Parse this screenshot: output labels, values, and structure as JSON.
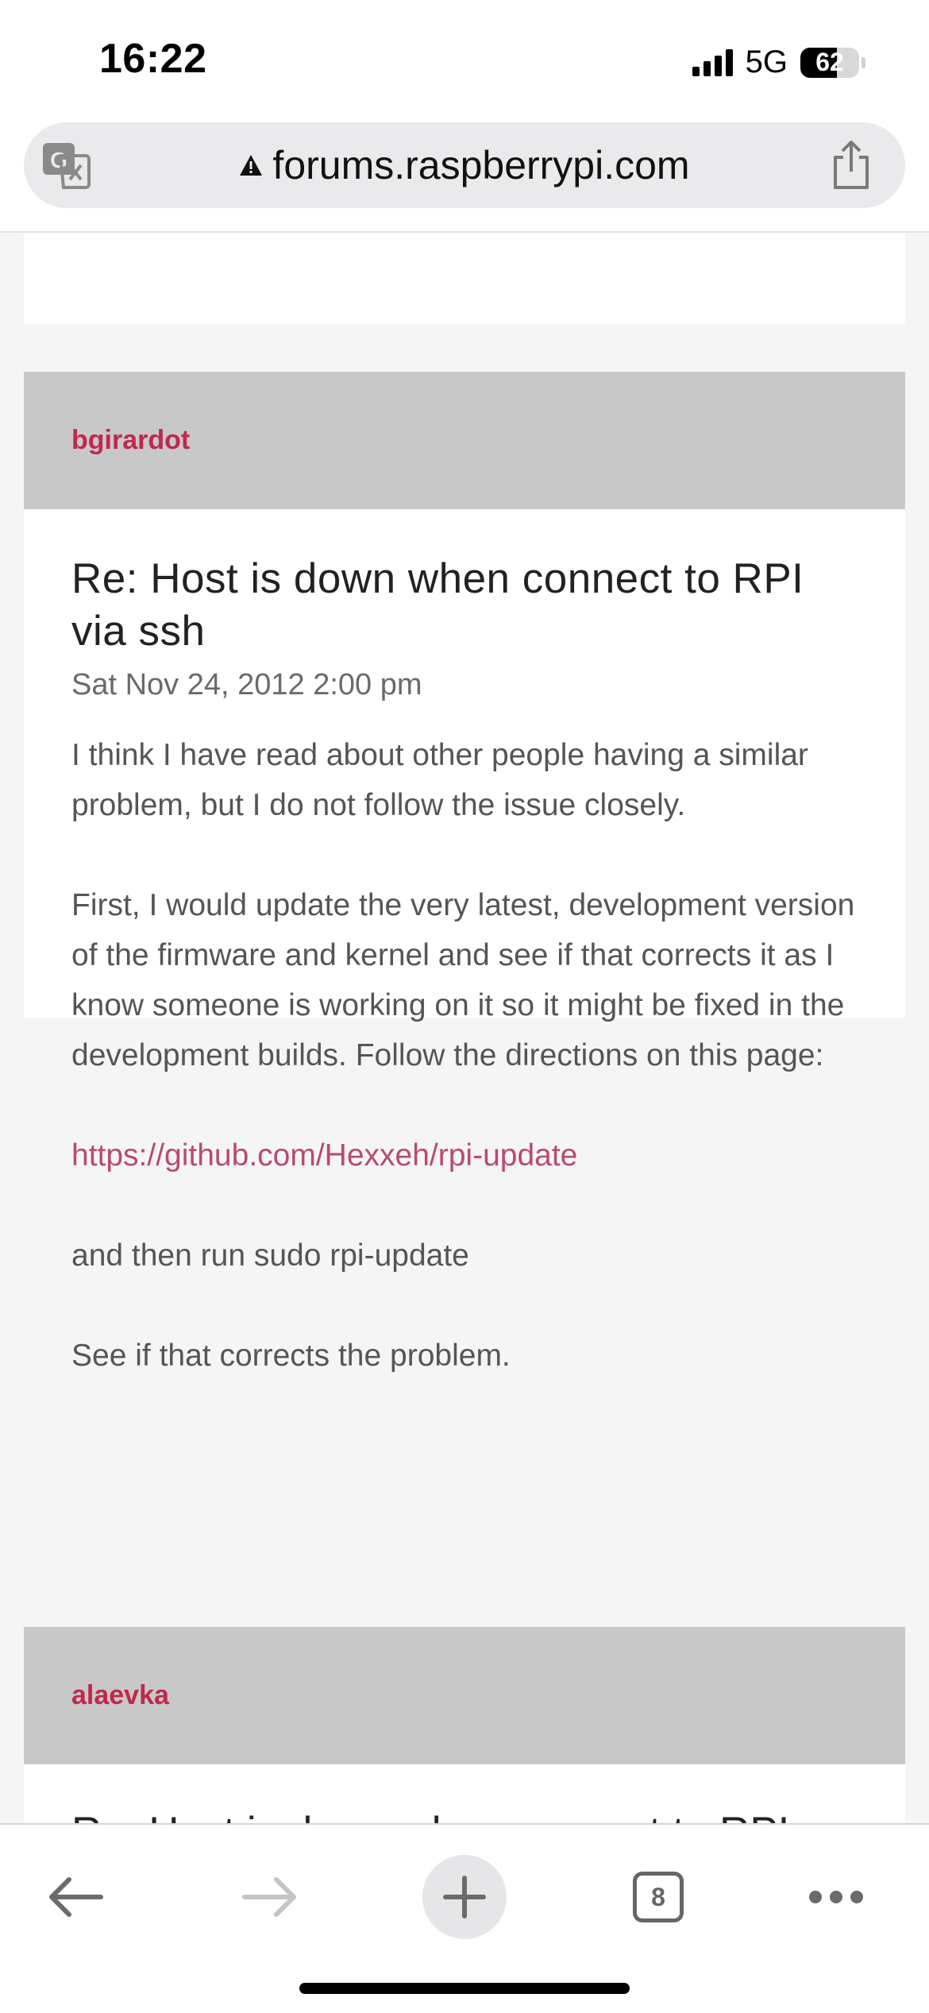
{
  "status_bar": {
    "time": "16:22",
    "network": "5G",
    "battery": "62",
    "battery_fraction": 0.62
  },
  "browser": {
    "url": "forums.raspberrypi.com",
    "tab_count": "8",
    "icons": {
      "translate": "translate-icon",
      "security": "warning-icon",
      "share": "share-icon",
      "back": "back-arrow-icon",
      "forward": "forward-arrow-icon",
      "new_tab": "plus-icon",
      "tabs": "tabs-icon",
      "more": "more-dots-icon"
    }
  },
  "posts": [
    {
      "author": "bgirardot",
      "title": "Re: Host is down when connect to RPI via ssh",
      "date": "Sat Nov 24, 2012 2:00 pm",
      "paragraphs": [
        "I think I have read about other people having a similar problem, but I do not follow the issue closely.",
        "First, I would update the very latest, development version of the firmware and kernel and see if that corrects it as I know someone is working on it so it might be fixed in the development builds. Follow the directions on this page:"
      ],
      "link": "https://github.com/Hexxeh/rpi-update",
      "after_link": [
        "and then run sudo rpi-update",
        "See if that corrects the problem."
      ]
    },
    {
      "author": "alaevka",
      "title_partial": "Re: Host is down when connect to RPI"
    }
  ],
  "colors": {
    "author": "#c1284e",
    "link": "#b84a73",
    "header_bg": "#c8c8c8",
    "page_bg": "#f5f5f5"
  }
}
